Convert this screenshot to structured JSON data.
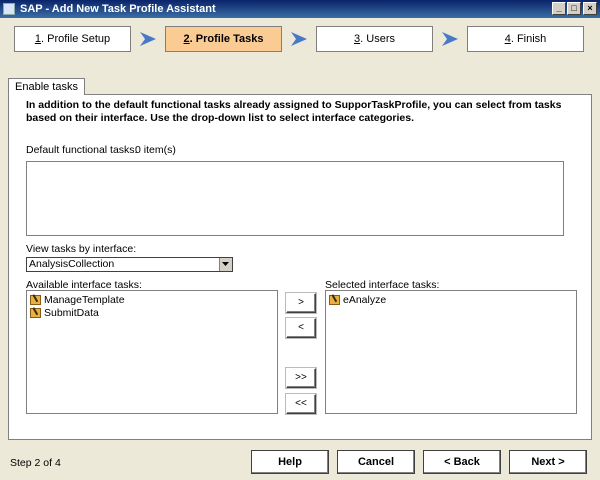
{
  "window": {
    "title": "SAP - Add New Task Profile Assistant"
  },
  "steps": [
    {
      "num": "1",
      "label": ". Profile Setup"
    },
    {
      "num": "2",
      "label": ". Profile Tasks"
    },
    {
      "num": "3",
      "label": ". Users"
    },
    {
      "num": "4",
      "label": ". Finish"
    }
  ],
  "active_step": 1,
  "tab": {
    "label": "Enable tasks"
  },
  "intro": "In addition to the default functional tasks already assigned to SupporTaskProfile, you can select from tasks based on their interface. Use the drop-down list to select interface categories.",
  "default_tasks": {
    "label": "Default functional tasks:",
    "count": "0 item(s)"
  },
  "view_by": {
    "label": "View tasks by interface:",
    "value": "AnalysisCollection"
  },
  "available": {
    "label": "Available interface tasks:",
    "items": [
      "ManageTemplate",
      "SubmitData"
    ]
  },
  "selected": {
    "label": "Selected interface tasks:",
    "items": [
      "eAnalyze"
    ]
  },
  "move": {
    "add": ">",
    "remove": "<",
    "add_all": ">>",
    "remove_all": "<<"
  },
  "footer": {
    "status": "Step 2 of 4",
    "help": "Help",
    "cancel": "Cancel",
    "back": "< Back",
    "next": "Next >"
  },
  "colors": {
    "active_step": "#fbcb94",
    "arrow": "#4a78c8"
  }
}
